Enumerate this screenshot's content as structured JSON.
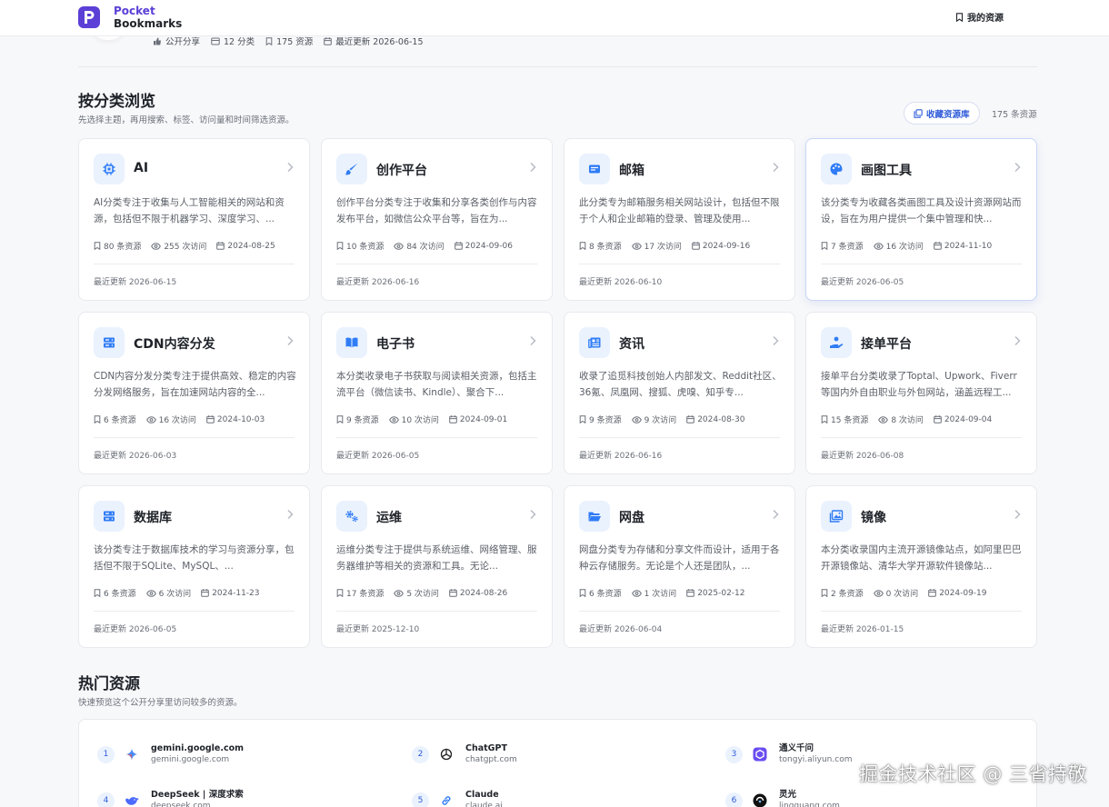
{
  "brand": {
    "line1": "Pocket",
    "line2": "Bookmarks"
  },
  "nav": {
    "my_resources": "我的资源"
  },
  "meta": {
    "public_share": "公开分享",
    "categories": "12 分类",
    "resources": "175 资源",
    "last_updated": "最近更新 2026-06-15"
  },
  "browse": {
    "title": "按分类浏览",
    "subtitle": "先选择主题，再用搜索、标签、访问量和时间筛选资源。",
    "collect_button": "收藏资源库",
    "total": "175 条资源"
  },
  "categories": [
    {
      "title": "AI",
      "desc": "AI分类专注于收集与人工智能相关的网站和资源，包括但不限于机器学习、深度学习、...",
      "count": "80 条资源",
      "visits": "255 次访问",
      "date": "2024-08-25",
      "updated": "最近更新 2026-06-15",
      "icon": "chip-icon"
    },
    {
      "title": "创作平台",
      "desc": "创作平台分类专注于收集和分享各类创作与内容发布平台，如微信公众平台等，旨在为...",
      "count": "10 条资源",
      "visits": "84 次访问",
      "date": "2024-09-06",
      "updated": "最近更新 2026-06-16",
      "icon": "brush-icon"
    },
    {
      "title": "邮箱",
      "desc": "此分类专为邮箱服务相关网站设计，包括但不限于个人和企业邮箱的登录、管理及使用...",
      "count": "8 条资源",
      "visits": "17 次访问",
      "date": "2024-09-16",
      "updated": "最近更新 2026-06-10",
      "icon": "mail-icon"
    },
    {
      "title": "画图工具",
      "desc": "该分类专为收藏各类画图工具及设计资源网站而设，旨在为用户提供一个集中管理和快...",
      "count": "7 条资源",
      "visits": "16 次访问",
      "date": "2024-11-10",
      "updated": "最近更新 2026-06-05",
      "icon": "palette-icon"
    },
    {
      "title": "CDN内容分发",
      "desc": "CDN内容分发分类专注于提供高效、稳定的内容分发网络服务，旨在加速网站内容的全...",
      "count": "6 条资源",
      "visits": "16 次访问",
      "date": "2024-10-03",
      "updated": "最近更新 2026-06-03",
      "icon": "server-icon"
    },
    {
      "title": "电子书",
      "desc": "本分类收录电子书获取与阅读相关资源，包括主流平台（微信读书、Kindle）、聚合下...",
      "count": "9 条资源",
      "visits": "10 次访问",
      "date": "2024-09-01",
      "updated": "最近更新 2026-06-05",
      "icon": "book-icon"
    },
    {
      "title": "资讯",
      "desc": "收录了追觅科技创始人内部发文、Reddit社区、36氪、凤凰网、搜狐、虎嗅、知乎专...",
      "count": "9 条资源",
      "visits": "9 次访问",
      "date": "2024-08-30",
      "updated": "最近更新 2026-06-16",
      "icon": "news-icon"
    },
    {
      "title": "接单平台",
      "desc": "接单平台分类收录了Toptal、Upwork、Fiverr等国内外自由职业与外包网站，涵盖远程工...",
      "count": "15 条资源",
      "visits": "8 次访问",
      "date": "2024-09-04",
      "updated": "最近更新 2026-06-08",
      "icon": "hand-icon"
    },
    {
      "title": "数据库",
      "desc": "该分类专注于数据库技术的学习与资源分享，包括但不限于SQLite、MySQL、...",
      "count": "6 条资源",
      "visits": "6 次访问",
      "date": "2024-11-23",
      "updated": "最近更新 2026-06-05",
      "icon": "database-icon"
    },
    {
      "title": "运维",
      "desc": "运维分类专注于提供与系统运维、网络管理、服务器维护等相关的资源和工具。无论...",
      "count": "17 条资源",
      "visits": "5 次访问",
      "date": "2024-08-26",
      "updated": "最近更新 2025-12-10",
      "icon": "gears-icon"
    },
    {
      "title": "网盘",
      "desc": "网盘分类专为存储和分享文件而设计，适用于各种云存储服务。无论是个人还是团队，...",
      "count": "6 条资源",
      "visits": "1 次访问",
      "date": "2025-02-12",
      "updated": "最近更新 2026-06-04",
      "icon": "folder-icon"
    },
    {
      "title": "镜像",
      "desc": "本分类收录国内主流开源镜像站点，如阿里巴巴开源镜像站、清华大学开源软件镜像站...",
      "count": "2 条资源",
      "visits": "0 次访问",
      "date": "2024-09-19",
      "updated": "最近更新 2026-01-15",
      "icon": "image-icon"
    }
  ],
  "hot": {
    "title": "热门资源",
    "subtitle": "快速预览这个公开分享里访问较多的资源。",
    "items": [
      {
        "rank": "1",
        "name": "gemini.google.com",
        "domain": "gemini.google.com",
        "icon": "gemini-icon"
      },
      {
        "rank": "2",
        "name": "ChatGPT",
        "domain": "chatgpt.com",
        "icon": "openai-icon"
      },
      {
        "rank": "3",
        "name": "通义千问",
        "domain": "tongyi.aliyun.com",
        "icon": "tongyi-icon"
      },
      {
        "rank": "4",
        "name": "DeepSeek | 深度求索",
        "domain": "deepseek.com",
        "icon": "deepseek-icon"
      },
      {
        "rank": "5",
        "name": "Claude",
        "domain": "claude.ai",
        "icon": "link-icon"
      },
      {
        "rank": "6",
        "name": "灵光",
        "domain": "lingguang.com",
        "icon": "lingguang-icon"
      }
    ]
  },
  "watermark": "掘金技术社区 @ 三省持敬",
  "colors": {
    "accent": "#2f5bd9",
    "brand": "#5b3fd6",
    "icon_bg": "#eaf2fe"
  }
}
